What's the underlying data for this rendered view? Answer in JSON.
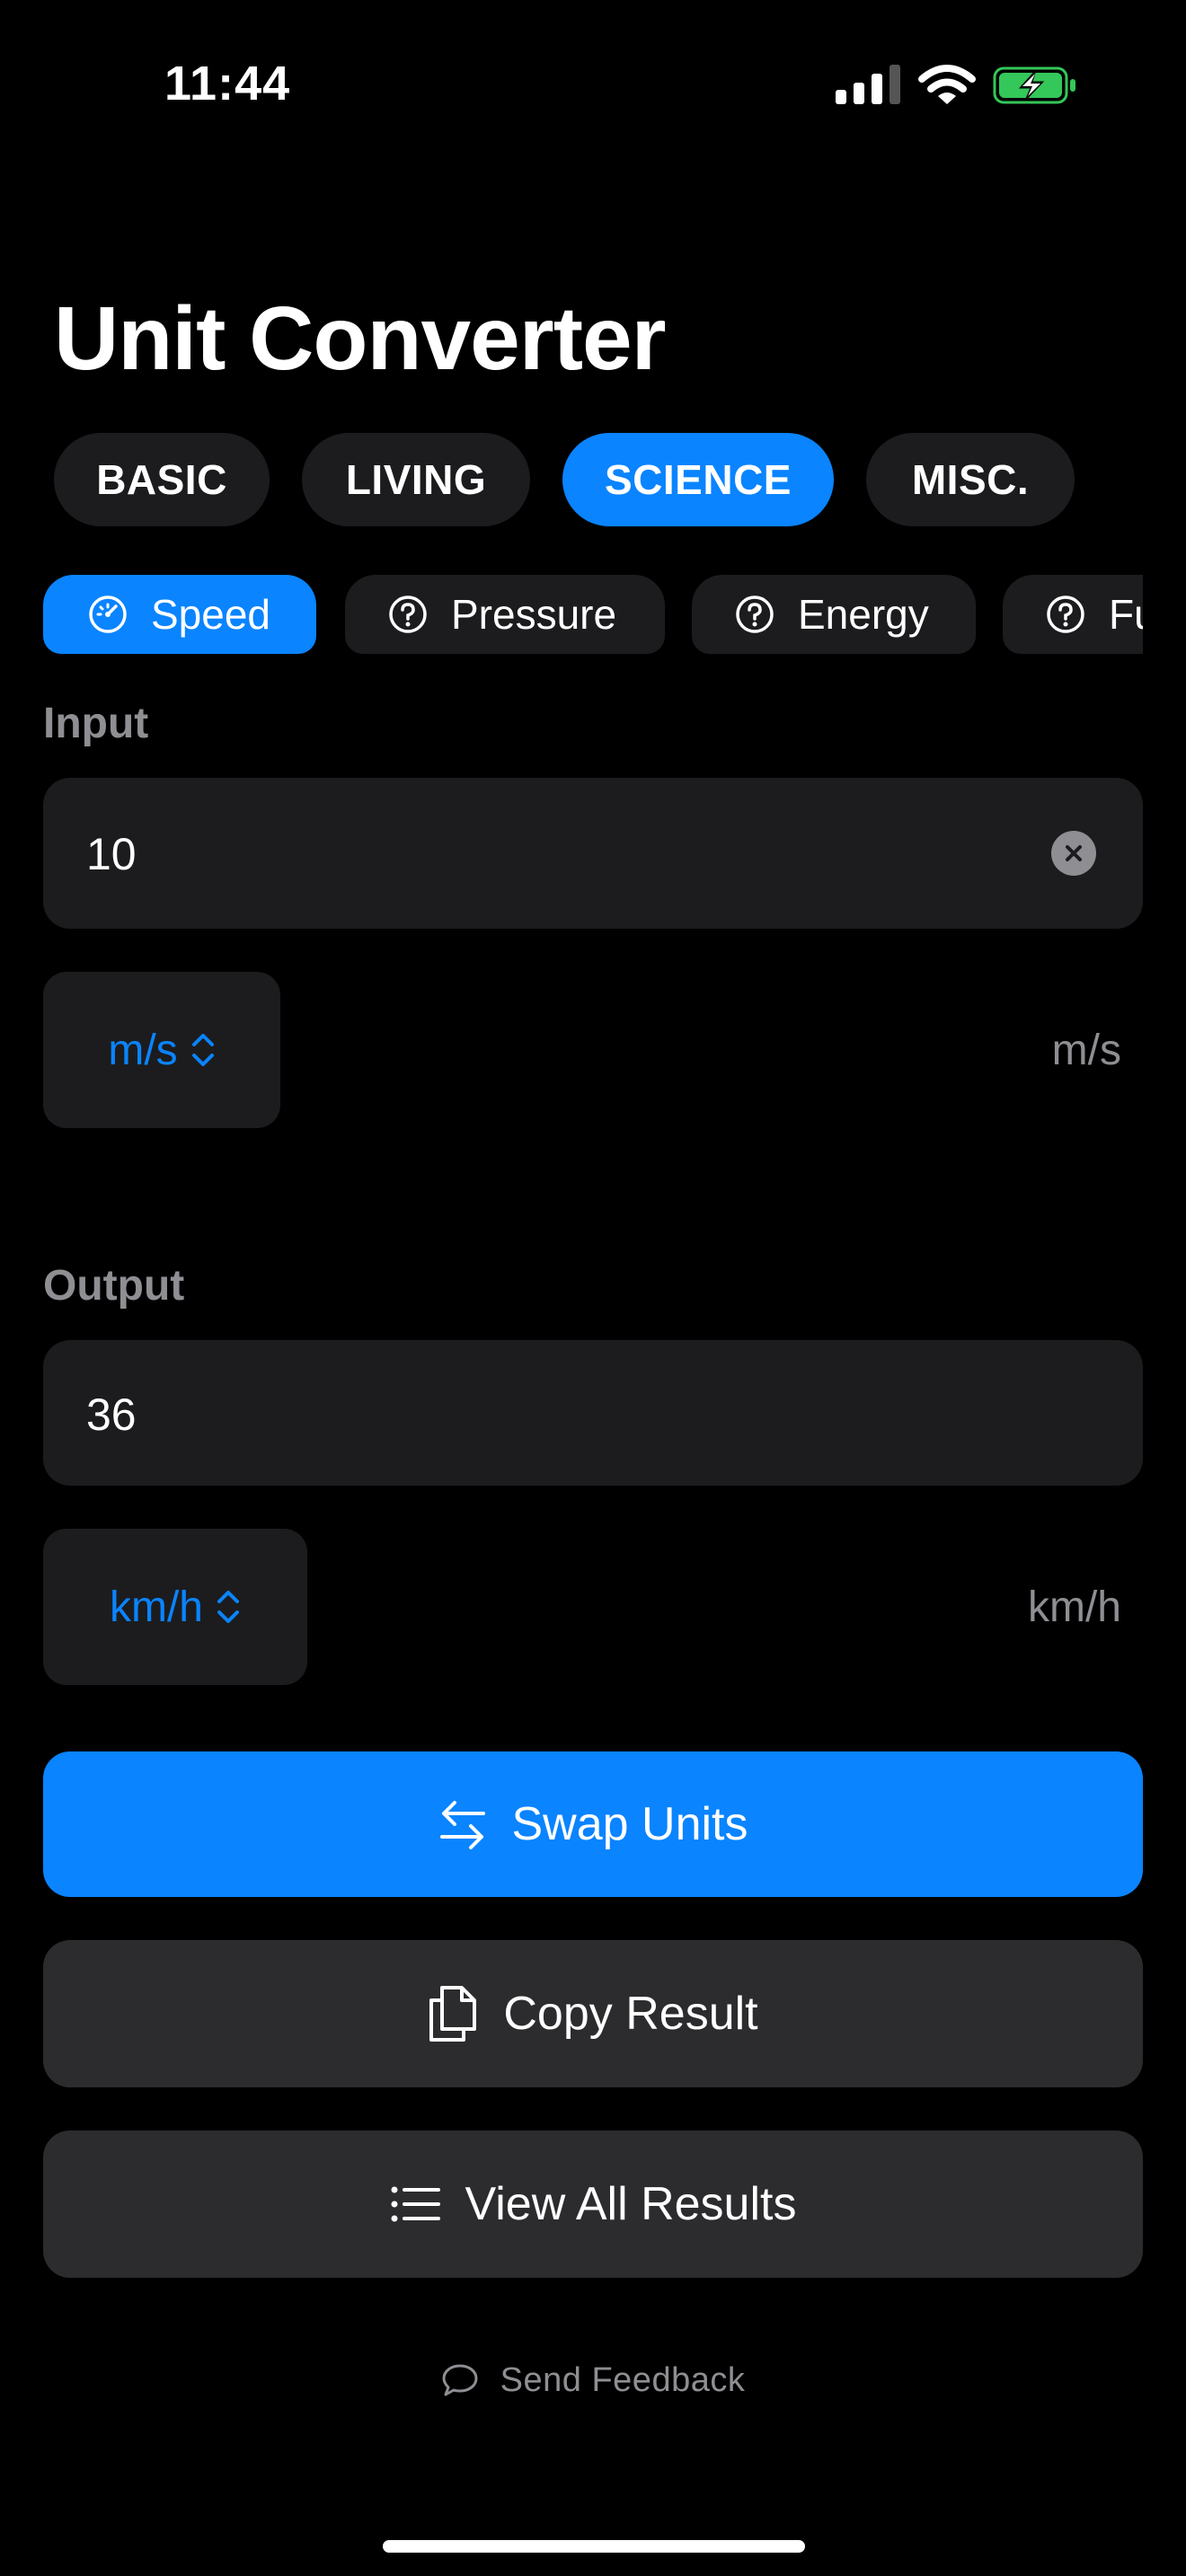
{
  "status_bar": {
    "time": "11:44",
    "icons": [
      "signal-icon",
      "wifi-icon",
      "battery-charging-icon"
    ]
  },
  "title": "Unit Converter",
  "categories": [
    {
      "label": "BASIC",
      "active": false
    },
    {
      "label": "LIVING",
      "active": false
    },
    {
      "label": "SCIENCE",
      "active": true
    },
    {
      "label": "MISC.",
      "active": false
    }
  ],
  "unit_types": [
    {
      "label": "Speed",
      "icon": "speedometer-icon",
      "active": true
    },
    {
      "label": "Pressure",
      "icon": "question-circle-icon",
      "active": false
    },
    {
      "label": "Energy",
      "icon": "question-circle-icon",
      "active": false
    },
    {
      "label": "Fu",
      "icon": "question-circle-icon",
      "active": false
    }
  ],
  "input": {
    "label": "Input",
    "value": "10",
    "unit": "m/s",
    "unit_label": "m/s"
  },
  "output": {
    "label": "Output",
    "value": "36",
    "unit": "km/h",
    "unit_label": "km/h"
  },
  "actions": {
    "swap": "Swap Units",
    "copy": "Copy Result",
    "view_all": "View All Results"
  },
  "feedback": "Send Feedback",
  "colors": {
    "accent": "#0a84ff",
    "background": "#000000",
    "surface": "#1c1c1e",
    "secondary_text": "#8e8e93",
    "battery": "#34c759"
  }
}
